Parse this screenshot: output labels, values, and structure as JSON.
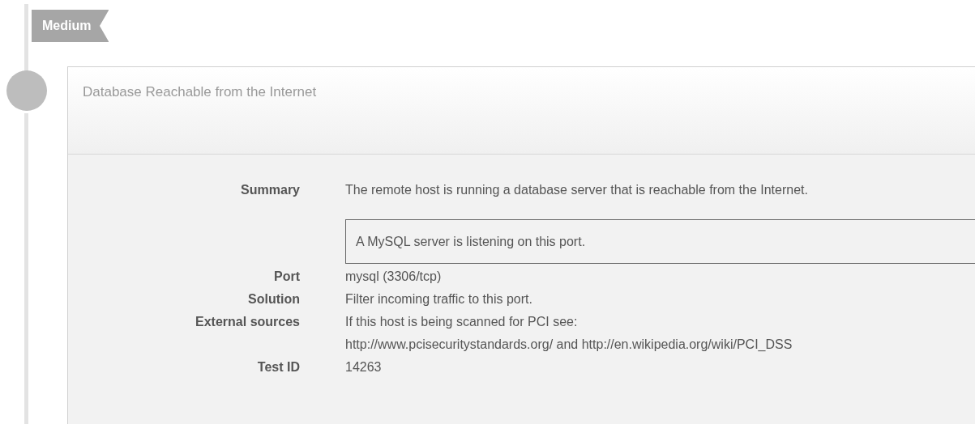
{
  "severity": {
    "label": "Medium"
  },
  "finding": {
    "title": "Database Reachable from the Internet",
    "summary_label": "Summary",
    "summary": "The remote host is running a database server that is reachable from the Internet.",
    "output": "A MySQL server is listening on this port.",
    "details": [
      {
        "label": "Port",
        "lines": [
          "mysql (3306/tcp)"
        ]
      },
      {
        "label": "Solution",
        "lines": [
          "Filter incoming traffic to this port."
        ]
      },
      {
        "label": "External sources",
        "lines": [
          "If this host is being scanned for PCI see:",
          "http://www.pcisecuritystandards.org/ and http://en.wikipedia.org/wiki/PCI_DSS"
        ]
      },
      {
        "label": "Test ID",
        "lines": [
          "14263"
        ]
      }
    ]
  }
}
